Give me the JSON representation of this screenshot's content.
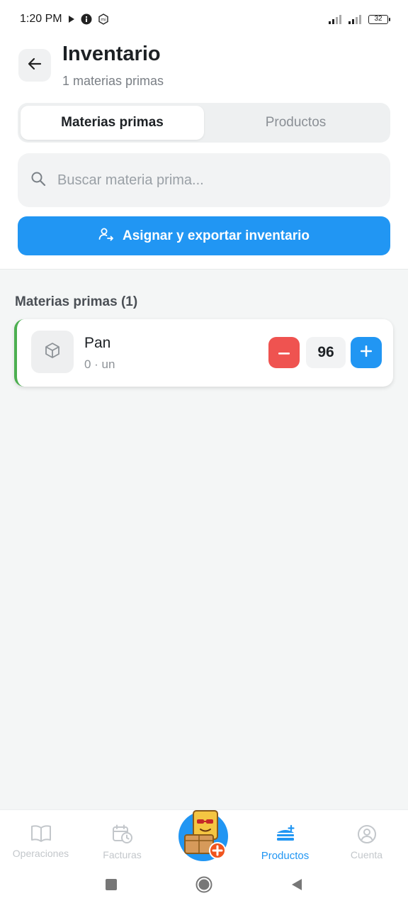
{
  "status_bar": {
    "time": "1:20 PM",
    "battery": "32",
    "icons": [
      "play-icon",
      "info-icon",
      "mi-icon",
      "signal-icon",
      "signal-icon",
      "battery-icon"
    ]
  },
  "header": {
    "title": "Inventario",
    "subtitle": "1 materias primas",
    "back_icon": "arrow-left-icon"
  },
  "tabs": [
    {
      "label": "Materias primas",
      "active": true
    },
    {
      "label": "Productos",
      "active": false
    }
  ],
  "search": {
    "placeholder": "Buscar materia prima...",
    "value": "",
    "icon": "search-icon"
  },
  "assign_button": {
    "label": "Asignar y exportar inventario",
    "icon": "user-assign-icon"
  },
  "section": {
    "title": "Materias primas (1)"
  },
  "items": [
    {
      "name": "Pan",
      "meta": "0 · un",
      "quantity": "96",
      "icon": "box-icon"
    }
  ],
  "bottom_nav": [
    {
      "label": "Operaciones",
      "icon": "book-icon",
      "active": false
    },
    {
      "label": "Facturas",
      "icon": "calendar-clock-icon",
      "active": false
    },
    {
      "label": "",
      "icon": "mascot-add-icon",
      "active": false
    },
    {
      "label": "Productos",
      "icon": "food-tray-icon",
      "active": true
    },
    {
      "label": "Cuenta",
      "icon": "user-circle-icon",
      "active": false
    }
  ],
  "colors": {
    "primary": "#2196f3",
    "danger": "#ef5350",
    "success": "#4caf50",
    "background": "#f4f6f6"
  }
}
